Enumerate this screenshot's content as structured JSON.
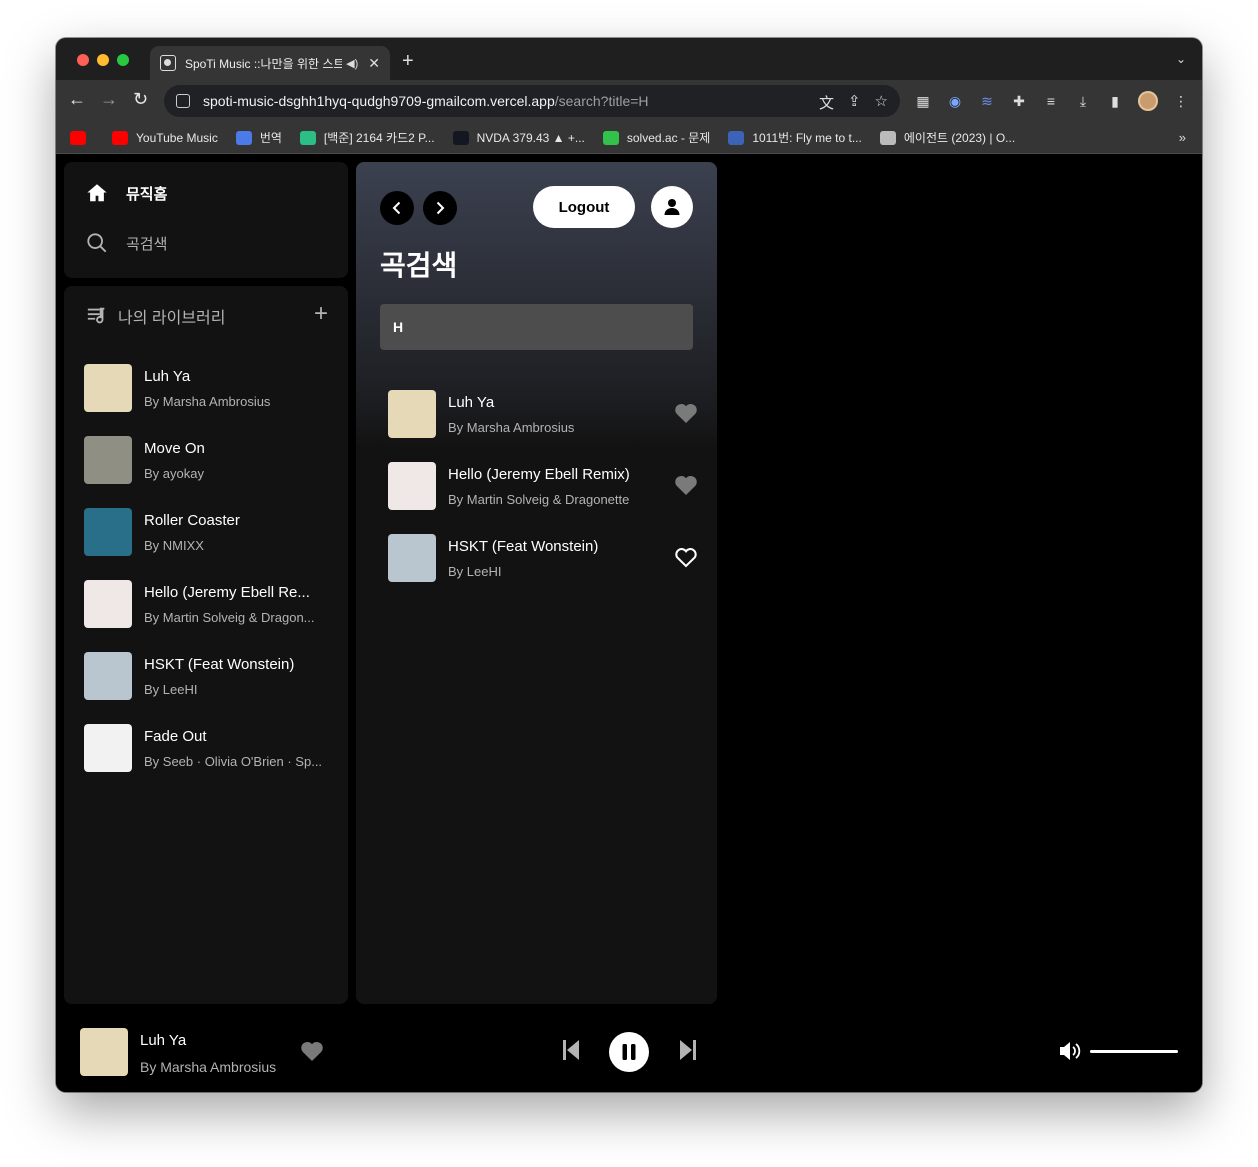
{
  "browser": {
    "tab_title": "SpoTi Music ::나만을 위한 스트",
    "url_host": "spoti-music-dsghh1hyq-qudgh9709-gmailcom.vercel.app",
    "url_path": "/search?title=H",
    "bookmarks": [
      {
        "label": "",
        "color": "#ff0000"
      },
      {
        "label": "YouTube Music",
        "color": "#ff0000"
      },
      {
        "label": "번역",
        "color": "#4a7be8"
      },
      {
        "label": "[백준] 2164 카드2 P...",
        "color": "#2bbf86"
      },
      {
        "label": "NVDA 379.43 ▲ +...",
        "color": "#131722"
      },
      {
        "label": "solved.ac - 문제",
        "color": "#32c14a"
      },
      {
        "label": "1011번: Fly me to t...",
        "color": "#3b63b8"
      },
      {
        "label": "에이전트 (2023) | O...",
        "color": "#bbbbbb"
      }
    ],
    "bookmarks_more": "»"
  },
  "nav": {
    "home_label": "뮤직홈",
    "search_label": "곡검색"
  },
  "library": {
    "heading": "나의 라이브러리",
    "add_icon": "+",
    "items": [
      {
        "title": "Luh Ya",
        "artist": "By Marsha Ambrosius",
        "cover_color": "#e6d9b8"
      },
      {
        "title": "Move On",
        "artist": "By ayokay",
        "cover_color": "#8f8f84"
      },
      {
        "title": "Roller Coaster",
        "artist": "By NMIXX",
        "cover_color": "#2a6f8a"
      },
      {
        "title": "Hello (Jeremy Ebell Re...",
        "artist": "By Martin Solveig & Dragon...",
        "cover_color": "#efe8e6"
      },
      {
        "title": "HSKT (Feat Wonstein)",
        "artist": "By LeeHI",
        "cover_color": "#b9c6cf"
      },
      {
        "title": "Fade Out",
        "artist": "By Seeb · Olivia O'Brien · Sp...",
        "cover_color": "#f2f2f2"
      }
    ]
  },
  "main": {
    "logout_label": "Logout",
    "page_title": "곡검색",
    "search_value": "H",
    "results": [
      {
        "title": "Luh Ya",
        "artist": "By Marsha Ambrosius",
        "liked": true,
        "cover_color": "#e6d9b8"
      },
      {
        "title": "Hello (Jeremy Ebell Remix)",
        "artist": "By Martin Solveig & Dragonette",
        "liked": true,
        "cover_color": "#efe8e6"
      },
      {
        "title": "HSKT (Feat Wonstein)",
        "artist": "By LeeHI",
        "liked": false,
        "cover_color": "#b9c6cf"
      }
    ]
  },
  "player": {
    "title": "Luh Ya",
    "artist": "By Marsha Ambrosius",
    "liked": true,
    "cover_color": "#e6d9b8",
    "volume": 1.0
  },
  "colors": {
    "panel": "#121212",
    "muted_text": "#b3b3b3",
    "heart_filled": "#7a7a7a"
  }
}
